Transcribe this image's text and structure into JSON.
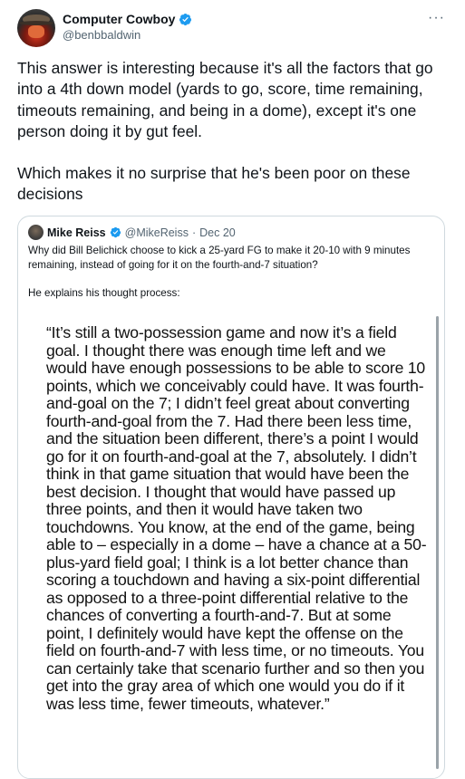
{
  "author": {
    "name": "Computer Cowboy",
    "handle": "@benbbaldwin",
    "avatar_icon": "cowboy-avatar",
    "verified_icon": "verified-badge-icon",
    "verified_color": "#1d9bf0"
  },
  "menu": {
    "icon": "more-options-icon",
    "label": "···"
  },
  "tweet": {
    "paragraph1": "This answer is interesting because it's all the factors that go into a 4th down model (yards to go, score, time remaining, timeouts remaining, and being in a dome), except it's one person doing it by gut feel.",
    "paragraph2": "Which makes it no surprise that he's been poor on these decisions"
  },
  "quoted": {
    "name": "Mike Reiss",
    "handle": "@MikeReiss",
    "separator": "·",
    "date": "Dec 20",
    "text1": "Why did Bill Belichick choose to kick a 25-yard FG to make it 20-10 with 9 minutes remaining, instead of going for it on the fourth-and-7 situation?",
    "text2": "He explains his thought process:",
    "image_quote": "“It’s still a two-possession game and now it’s a field goal. I thought there was enough time left and we would have enough possessions to be able to score 10 points, which we conceivably could have. It was fourth-and-goal on the 7; I didn’t feel great about converting fourth-and-goal from the 7. Had there been less time, and the situation been different, there’s a point I would go for it on fourth-and-goal at the 7, absolutely. I didn’t think in that game situation that would have been the best decision. I thought that would have passed up three points, and then it would have taken two touchdowns. You know, at the end of the game, being able to – especially in a dome – have a chance at a 50-plus-yard field goal; I think is a lot better chance than scoring a touchdown and having a six-point differential as opposed to a three-point differential relative to the chances of converting a fourth-and-7. But at some point, I definitely would have kept the offense on the field on fourth-and-7 with less time, or no timeouts. You can certainly take that scenario further and so then you get into the gray area of which one would you do if it was less time, fewer timeouts, whatever.”"
  }
}
